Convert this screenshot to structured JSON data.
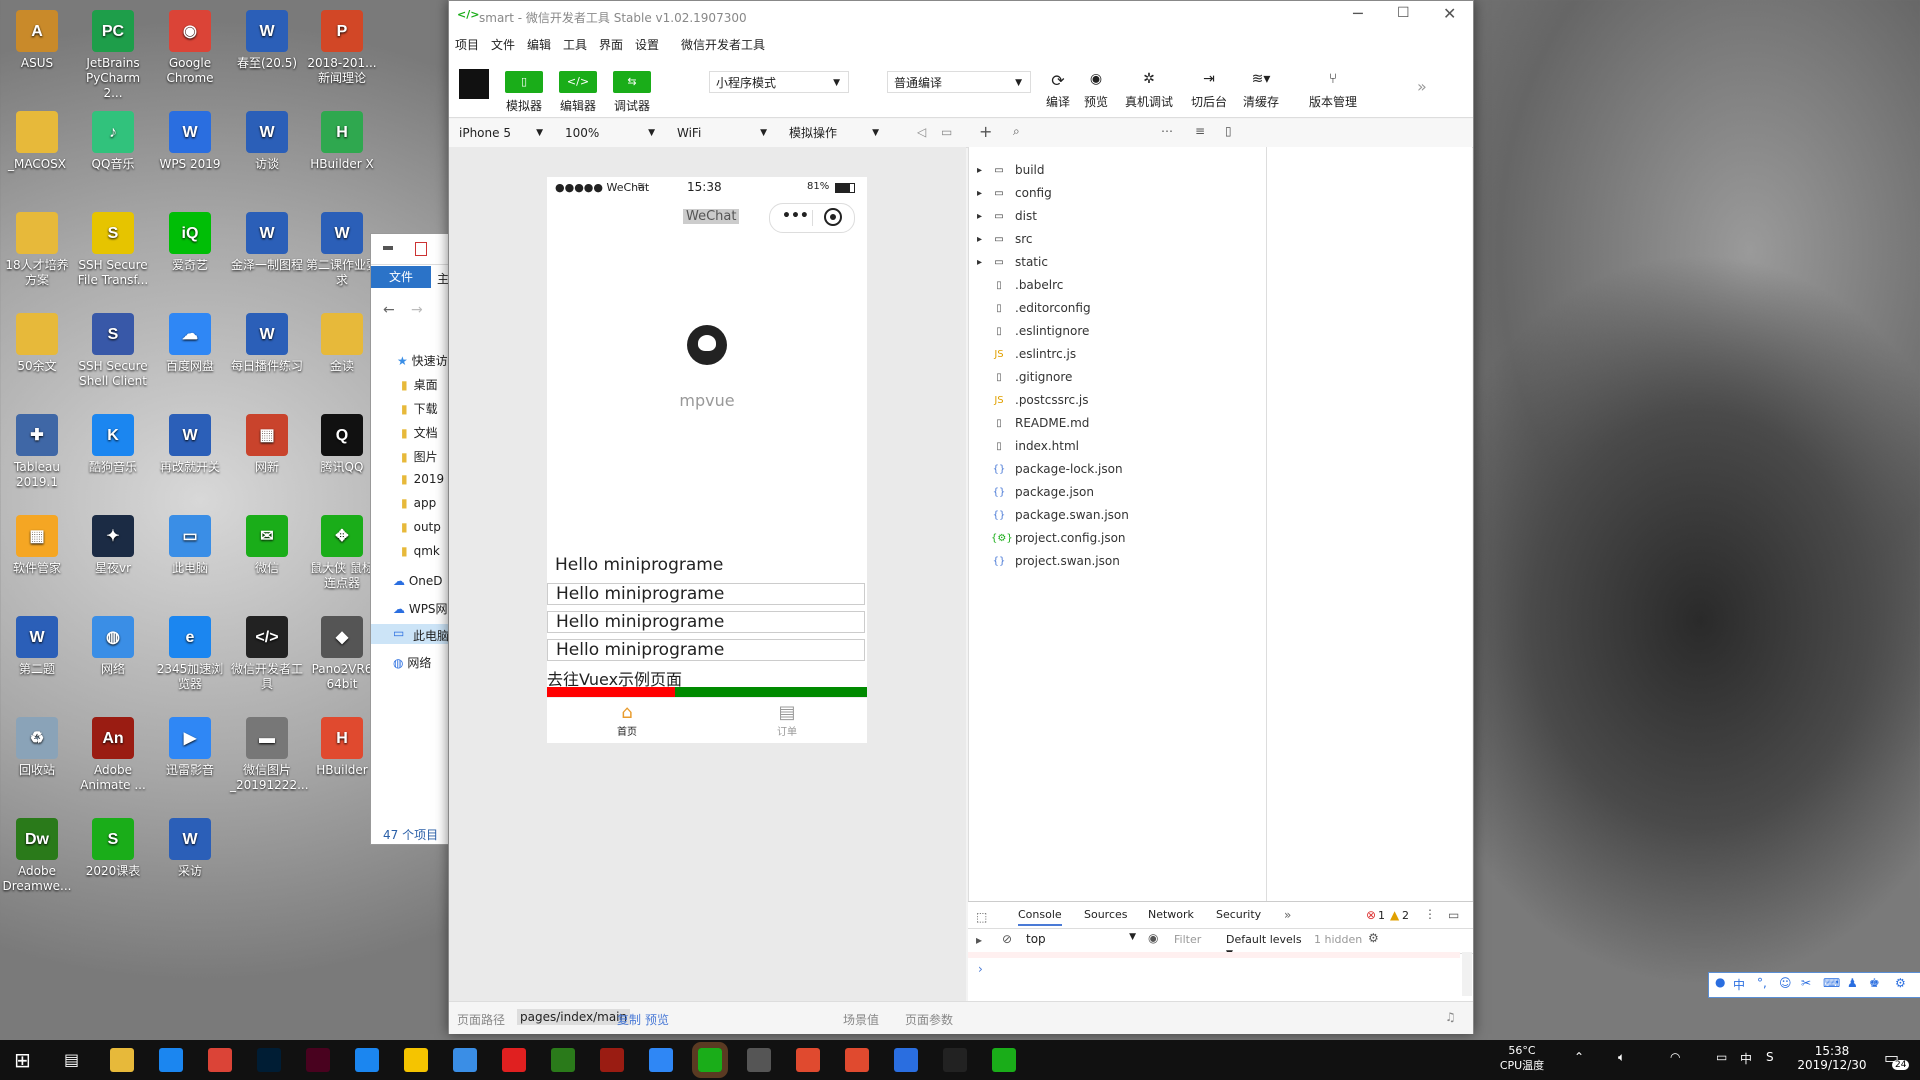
{
  "desktop_icons": [
    {
      "label": "ASUS",
      "color": "#c98a2a",
      "glyph": "A"
    },
    {
      "label": "JetBrains PyCharm 2...",
      "color": "#1e9e4a",
      "glyph": "PC"
    },
    {
      "label": "Google Chrome",
      "color": "#db4437",
      "glyph": "◉"
    },
    {
      "label": "春至(20.5)",
      "color": "#2b5fb8",
      "glyph": "W"
    },
    {
      "label": "2018-201... 新闻理论",
      "color": "#d24726",
      "glyph": "P"
    },
    {
      "label": "_MACOSX",
      "color": "#e7b93a",
      "glyph": ""
    },
    {
      "label": "QQ音乐",
      "color": "#31c27c",
      "glyph": "♪"
    },
    {
      "label": "WPS 2019",
      "color": "#2a6ee0",
      "glyph": "W"
    },
    {
      "label": "访谈",
      "color": "#2b5fb8",
      "glyph": "W"
    },
    {
      "label": "HBuilder X",
      "color": "#2fa84f",
      "glyph": "H"
    },
    {
      "label": "18人才培养方案",
      "color": "#e7b93a",
      "glyph": ""
    },
    {
      "label": "SSH Secure File Transf...",
      "color": "#e6c400",
      "glyph": "S"
    },
    {
      "label": "爱奇艺",
      "color": "#00be06",
      "glyph": "iQ"
    },
    {
      "label": "金泽一制图程",
      "color": "#2b5fb8",
      "glyph": "W"
    },
    {
      "label": "第二课作业要求",
      "color": "#2b5fb8",
      "glyph": "W"
    },
    {
      "label": "50余文",
      "color": "#e7b93a",
      "glyph": ""
    },
    {
      "label": "SSH Secure Shell Client",
      "color": "#3858a8",
      "glyph": "S"
    },
    {
      "label": "百度网盘",
      "color": "#2f87f5",
      "glyph": "☁"
    },
    {
      "label": "每日播件练习",
      "color": "#2b5fb8",
      "glyph": "W"
    },
    {
      "label": "金读",
      "color": "#e7b93a",
      "glyph": ""
    },
    {
      "label": "Tableau 2019.1",
      "color": "#3f67a6",
      "glyph": "✚"
    },
    {
      "label": "酷狗音乐",
      "color": "#1b86f0",
      "glyph": "K"
    },
    {
      "label": "再改就开关",
      "color": "#2b5fb8",
      "glyph": "W"
    },
    {
      "label": "网新",
      "color": "#c9432c",
      "glyph": "▦"
    },
    {
      "label": "腾讯QQ",
      "color": "#111111",
      "glyph": "Q"
    },
    {
      "label": "软件管家",
      "color": "#f5a623",
      "glyph": "▦"
    },
    {
      "label": "星夜vr",
      "color": "#1b2b44",
      "glyph": "✦"
    },
    {
      "label": "此电脑",
      "color": "#3a8ee6",
      "glyph": "▭"
    },
    {
      "label": "微信",
      "color": "#1aad19",
      "glyph": "✉"
    },
    {
      "label": "鼠大侠 鼠标连点器",
      "color": "#1aad19",
      "glyph": "✥"
    },
    {
      "label": "第二题",
      "color": "#2b5fb8",
      "glyph": "W"
    },
    {
      "label": "网络",
      "color": "#3a8ee6",
      "glyph": "◍"
    },
    {
      "label": "2345加速浏览器",
      "color": "#1b86f0",
      "glyph": "e"
    },
    {
      "label": "微信开发者工具",
      "color": "#222222",
      "glyph": "</>"
    },
    {
      "label": "Pano2VR6 64bit",
      "color": "#555555",
      "glyph": "◆"
    },
    {
      "label": "回收站",
      "color": "#8aa3b8",
      "glyph": "♻"
    },
    {
      "label": "Adobe Animate ...",
      "color": "#9a1c12",
      "glyph": "An"
    },
    {
      "label": "迅雷影音",
      "color": "#2f87f5",
      "glyph": "▶"
    },
    {
      "label": "微信图片_20191222...",
      "color": "#777777",
      "glyph": "▬"
    },
    {
      "label": "HBuilder",
      "color": "#e04a2f",
      "glyph": "H"
    },
    {
      "label": "Adobe Dreamwe...",
      "color": "#2a7a1a",
      "glyph": "Dw"
    },
    {
      "label": "2020课表",
      "color": "#1aad19",
      "glyph": "S"
    },
    {
      "label": "采访",
      "color": "#2b5fb8",
      "glyph": "W"
    }
  ],
  "explorer": {
    "ribbon_tab": "文件",
    "tab2": "主",
    "quick_access": "快速访",
    "items": [
      "桌面",
      "下载",
      "文档",
      "图片",
      "2019",
      "app",
      "outp",
      "qmk"
    ],
    "onedrive": "OneD",
    "wps": "WPS网",
    "this_pc": "此电脑",
    "network": "网络",
    "count": "47 个项目"
  },
  "window": {
    "title": "smart - 微信开发者工具 Stable v1.02.1907300",
    "menus": [
      "项目",
      "文件",
      "编辑",
      "工具",
      "界面",
      "设置",
      "微信开发者工具"
    ],
    "toolbar": {
      "simulator": "模拟器",
      "editor": "编辑器",
      "debugger": "调试器",
      "mode": "小程序模式",
      "compile_mode": "普通编译",
      "compile": "编译",
      "preview": "预览",
      "remote_debug": "真机调试",
      "background": "切后台",
      "clear_cache": "清缓存",
      "version": "版本管理"
    },
    "device": "iPhone 5",
    "zoom": "100%",
    "network": "WiFi",
    "sim_op": "模拟操作"
  },
  "phone": {
    "carrier": "●●●●● WeChat",
    "time": "15:38",
    "battery": "81%",
    "nav_title": "WeChat",
    "app_name": "mpvue",
    "hello_plain": "Hello miniprograme",
    "hello_boxes": [
      "Hello miniprograme",
      "Hello miniprograme",
      "Hello miniprograme"
    ],
    "vuex_link": "去往Vuex示例页面",
    "progress_red_fraction": 0.4,
    "tabs": [
      {
        "label": "首页"
      },
      {
        "label": "订单"
      }
    ]
  },
  "files": [
    {
      "name": "build",
      "type": "folder"
    },
    {
      "name": "config",
      "type": "folder"
    },
    {
      "name": "dist",
      "type": "folder"
    },
    {
      "name": "src",
      "type": "folder"
    },
    {
      "name": "static",
      "type": "folder"
    },
    {
      "name": ".babelrc",
      "type": "file"
    },
    {
      "name": ".editorconfig",
      "type": "file"
    },
    {
      "name": ".eslintignore",
      "type": "file"
    },
    {
      "name": ".eslintrc.js",
      "type": "js"
    },
    {
      "name": ".gitignore",
      "type": "file"
    },
    {
      "name": ".postcssrc.js",
      "type": "js"
    },
    {
      "name": "README.md",
      "type": "file"
    },
    {
      "name": "index.html",
      "type": "file"
    },
    {
      "name": "package-lock.json",
      "type": "json"
    },
    {
      "name": "package.json",
      "type": "json"
    },
    {
      "name": "package.swan.json",
      "type": "json"
    },
    {
      "name": "project.config.json",
      "type": "config"
    },
    {
      "name": "project.swan.json",
      "type": "json"
    }
  ],
  "console": {
    "tabs": [
      "Console",
      "Sources",
      "Network",
      "Security"
    ],
    "errors": "1",
    "warnings": "2",
    "context": "top",
    "filter_placeholder": "Filter",
    "levels": "Default levels",
    "hidden": "1 hidden"
  },
  "status": {
    "path_label": "页面路径",
    "path": "pages/index/main",
    "copy": "复制",
    "preview": "预览",
    "scene": "场景值",
    "params": "页面参数"
  },
  "taskbar": {
    "temp": "56°C",
    "temp_label": "CPU温度",
    "ime1": "中",
    "time": "15:38",
    "date": "2019/12/30",
    "notif": "24"
  },
  "ime_bar": "中"
}
